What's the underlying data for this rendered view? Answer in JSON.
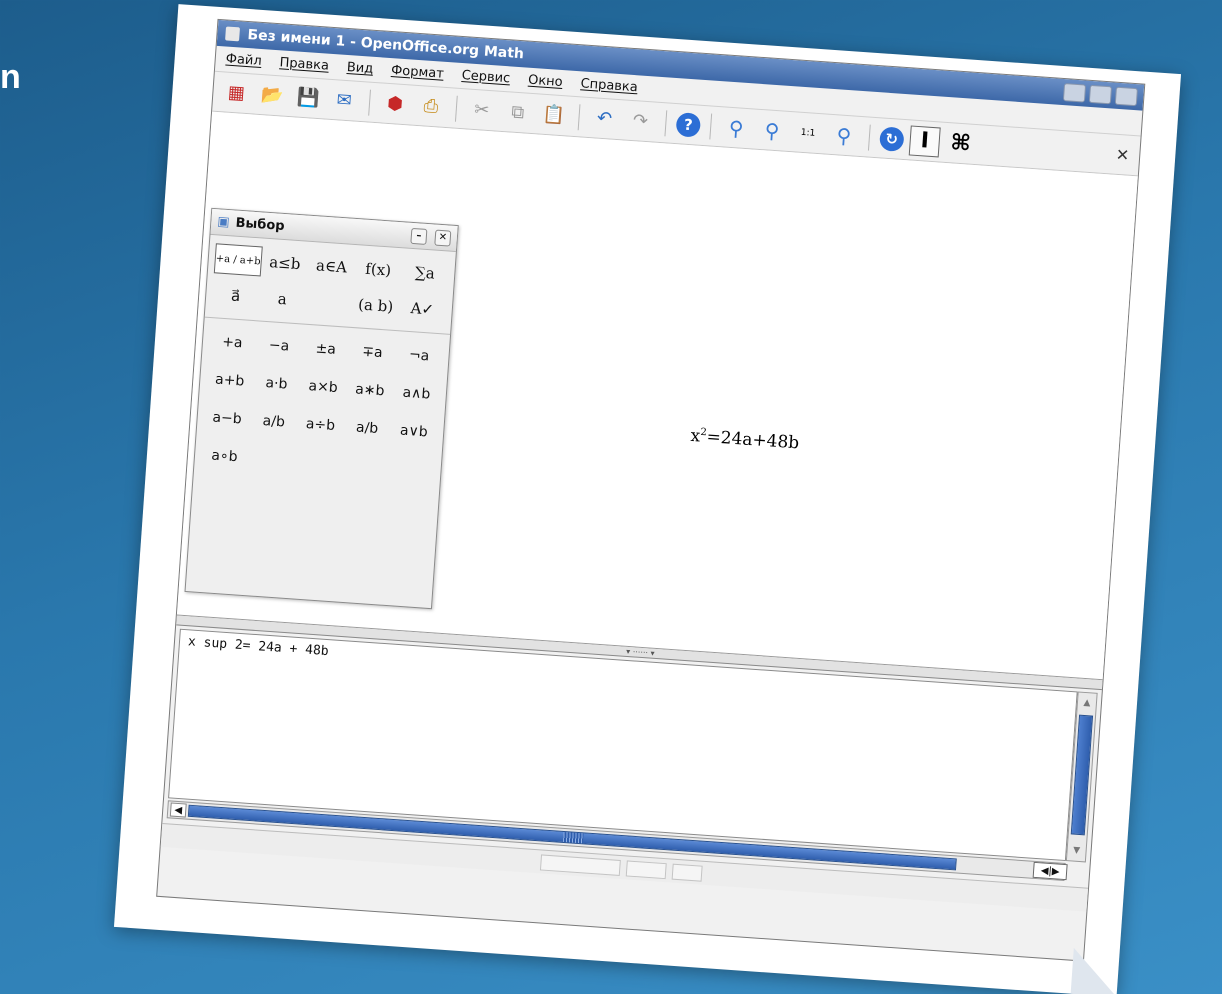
{
  "slide": {
    "letter": "n"
  },
  "app": {
    "title": "Без имени 1 - OpenOffice.org Math"
  },
  "menu": {
    "items": [
      "Файл",
      "Правка",
      "Вид",
      "Формат",
      "Сервис",
      "Окно",
      "Справка"
    ]
  },
  "toolbar": {
    "icons": [
      "new-document-icon",
      "open-folder-icon",
      "save-icon",
      "email-icon",
      "pdf-export-icon",
      "print-icon",
      "cut-icon",
      "copy-icon",
      "paste-icon",
      "undo-icon",
      "redo-icon",
      "help-icon",
      "zoom-in-icon",
      "zoom-out-icon",
      "zoom-100-icon",
      "zoom-all-icon",
      "refresh-icon",
      "text-cursor-icon",
      "command-icon"
    ],
    "zoom_100_label": "1:1",
    "cursor_label": "I",
    "command_label": "⌘"
  },
  "panel": {
    "title": "Выбор",
    "categories": [
      "+a / a+b",
      "a≤b",
      "a∈A",
      "f(x)",
      "∑a",
      "a⃗",
      "a",
      "",
      "(a b)",
      "A✓"
    ],
    "operators": [
      "+a",
      "−a",
      "±a",
      "∓a",
      "¬a",
      "a+b",
      "a·b",
      "a×b",
      "a∗b",
      "a∧b",
      "a−b",
      "a/b",
      "a÷b",
      "a/b",
      "a∨b",
      "a∘b"
    ]
  },
  "document": {
    "formula_base": "x",
    "formula_sup": "2",
    "formula_rest": "=24a+48b"
  },
  "command": {
    "text": "x sup 2= 24a + 48b"
  },
  "colors": {
    "background": "#2a78ad",
    "scroll_thumb": "#2f5ead",
    "pdf_red": "#c62828"
  }
}
